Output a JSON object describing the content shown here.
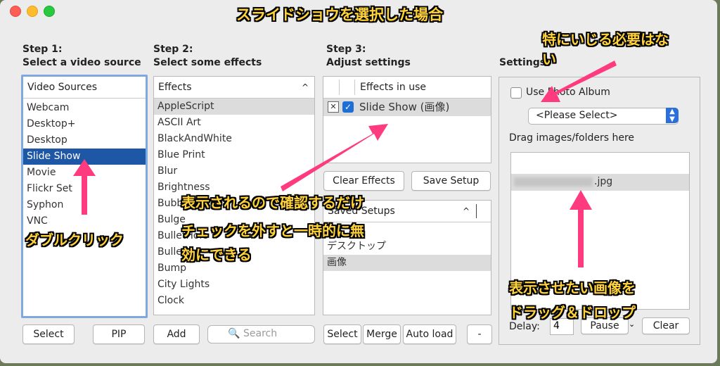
{
  "title_annotation": "スライドショウを選択した場合",
  "step1": {
    "title_line1": "Step 1:",
    "title_line2": "Select a video source",
    "header": "Video Sources",
    "items": [
      "Webcam",
      "Desktop+",
      "Desktop",
      "Slide Show",
      "Movie",
      "Flickr Set",
      "Syphon",
      "VNC"
    ],
    "selected": "Slide Show",
    "select_button": "Select",
    "pip_button": "PIP"
  },
  "step2": {
    "title_line1": "Step 2:",
    "title_line2": "Select some effects",
    "header": "Effects",
    "items": [
      "AppleScript",
      "ASCII Art",
      "BlackAndWhite",
      "Blue Print",
      "Blur",
      "Brightness",
      "Bubbles",
      "Bulge",
      "BulletHole",
      "Bullets",
      "Bump",
      "City Lights",
      "Clock"
    ],
    "add_button": "Add",
    "search_placeholder": "Search"
  },
  "step3": {
    "title_line1": "Step 3:",
    "title_line2": "Adjust settings",
    "header": "Effects in use",
    "effect_in_use": "Slide Show (画像)",
    "clear_effects_button": "Clear Effects",
    "save_setup_button": "Save Setup",
    "saved_setups_header": "Saved Setups",
    "saved_setups": [
      "デスクトップ",
      "画像"
    ],
    "select_button": "Select",
    "merge_button": "Merge",
    "auto_load_button": "Auto load",
    "minus_button": "-"
  },
  "settings": {
    "title": "Settings",
    "use_photo_album": "Use Photo Album",
    "album_select": "<Please Select>",
    "drag_hint": "Drag images/folders here",
    "file_name": ".jpg",
    "delay_label": "Delay:",
    "delay_value": "4",
    "pause_button": "Pause",
    "clear_button": "Clear"
  },
  "annotations": {
    "no_change_line1": "特にいじる必要はな",
    "no_change_line2": "い",
    "double_click": "ダブルクリック",
    "display_confirm": "表示されるので確認するだけ",
    "uncheck_line1": "チェックを外すと一時的に無",
    "uncheck_line2": "効にできる",
    "drag_drop_line1": "表示させたい画像を",
    "drag_drop_line2": "ドラッグ＆ドロップ"
  },
  "colors": {
    "selection": "#1f57a7",
    "annotation_text": "#ffd23a",
    "arrow": "#ff3b7f",
    "focus_ring": "#7fa7e0"
  }
}
